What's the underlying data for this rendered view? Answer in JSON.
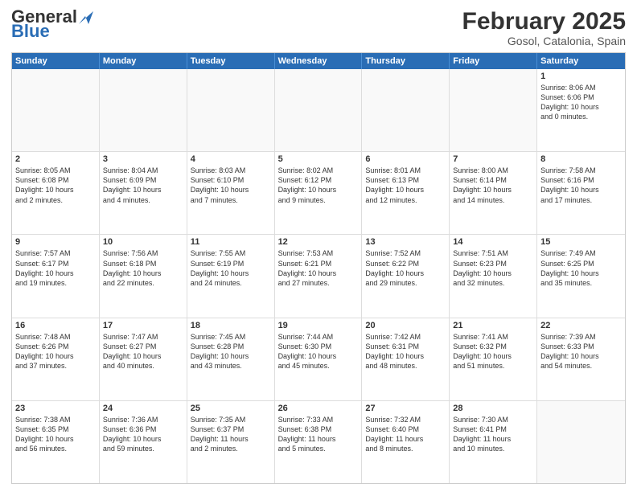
{
  "header": {
    "logo_general": "General",
    "logo_blue": "Blue",
    "month_title": "February 2025",
    "location": "Gosol, Catalonia, Spain"
  },
  "calendar": {
    "days_of_week": [
      "Sunday",
      "Monday",
      "Tuesday",
      "Wednesday",
      "Thursday",
      "Friday",
      "Saturday"
    ],
    "weeks": [
      [
        {
          "day": "",
          "info": ""
        },
        {
          "day": "",
          "info": ""
        },
        {
          "day": "",
          "info": ""
        },
        {
          "day": "",
          "info": ""
        },
        {
          "day": "",
          "info": ""
        },
        {
          "day": "",
          "info": ""
        },
        {
          "day": "1",
          "info": "Sunrise: 8:06 AM\nSunset: 6:06 PM\nDaylight: 10 hours\nand 0 minutes."
        }
      ],
      [
        {
          "day": "2",
          "info": "Sunrise: 8:05 AM\nSunset: 6:08 PM\nDaylight: 10 hours\nand 2 minutes."
        },
        {
          "day": "3",
          "info": "Sunrise: 8:04 AM\nSunset: 6:09 PM\nDaylight: 10 hours\nand 4 minutes."
        },
        {
          "day": "4",
          "info": "Sunrise: 8:03 AM\nSunset: 6:10 PM\nDaylight: 10 hours\nand 7 minutes."
        },
        {
          "day": "5",
          "info": "Sunrise: 8:02 AM\nSunset: 6:12 PM\nDaylight: 10 hours\nand 9 minutes."
        },
        {
          "day": "6",
          "info": "Sunrise: 8:01 AM\nSunset: 6:13 PM\nDaylight: 10 hours\nand 12 minutes."
        },
        {
          "day": "7",
          "info": "Sunrise: 8:00 AM\nSunset: 6:14 PM\nDaylight: 10 hours\nand 14 minutes."
        },
        {
          "day": "8",
          "info": "Sunrise: 7:58 AM\nSunset: 6:16 PM\nDaylight: 10 hours\nand 17 minutes."
        }
      ],
      [
        {
          "day": "9",
          "info": "Sunrise: 7:57 AM\nSunset: 6:17 PM\nDaylight: 10 hours\nand 19 minutes."
        },
        {
          "day": "10",
          "info": "Sunrise: 7:56 AM\nSunset: 6:18 PM\nDaylight: 10 hours\nand 22 minutes."
        },
        {
          "day": "11",
          "info": "Sunrise: 7:55 AM\nSunset: 6:19 PM\nDaylight: 10 hours\nand 24 minutes."
        },
        {
          "day": "12",
          "info": "Sunrise: 7:53 AM\nSunset: 6:21 PM\nDaylight: 10 hours\nand 27 minutes."
        },
        {
          "day": "13",
          "info": "Sunrise: 7:52 AM\nSunset: 6:22 PM\nDaylight: 10 hours\nand 29 minutes."
        },
        {
          "day": "14",
          "info": "Sunrise: 7:51 AM\nSunset: 6:23 PM\nDaylight: 10 hours\nand 32 minutes."
        },
        {
          "day": "15",
          "info": "Sunrise: 7:49 AM\nSunset: 6:25 PM\nDaylight: 10 hours\nand 35 minutes."
        }
      ],
      [
        {
          "day": "16",
          "info": "Sunrise: 7:48 AM\nSunset: 6:26 PM\nDaylight: 10 hours\nand 37 minutes."
        },
        {
          "day": "17",
          "info": "Sunrise: 7:47 AM\nSunset: 6:27 PM\nDaylight: 10 hours\nand 40 minutes."
        },
        {
          "day": "18",
          "info": "Sunrise: 7:45 AM\nSunset: 6:28 PM\nDaylight: 10 hours\nand 43 minutes."
        },
        {
          "day": "19",
          "info": "Sunrise: 7:44 AM\nSunset: 6:30 PM\nDaylight: 10 hours\nand 45 minutes."
        },
        {
          "day": "20",
          "info": "Sunrise: 7:42 AM\nSunset: 6:31 PM\nDaylight: 10 hours\nand 48 minutes."
        },
        {
          "day": "21",
          "info": "Sunrise: 7:41 AM\nSunset: 6:32 PM\nDaylight: 10 hours\nand 51 minutes."
        },
        {
          "day": "22",
          "info": "Sunrise: 7:39 AM\nSunset: 6:33 PM\nDaylight: 10 hours\nand 54 minutes."
        }
      ],
      [
        {
          "day": "23",
          "info": "Sunrise: 7:38 AM\nSunset: 6:35 PM\nDaylight: 10 hours\nand 56 minutes."
        },
        {
          "day": "24",
          "info": "Sunrise: 7:36 AM\nSunset: 6:36 PM\nDaylight: 10 hours\nand 59 minutes."
        },
        {
          "day": "25",
          "info": "Sunrise: 7:35 AM\nSunset: 6:37 PM\nDaylight: 11 hours\nand 2 minutes."
        },
        {
          "day": "26",
          "info": "Sunrise: 7:33 AM\nSunset: 6:38 PM\nDaylight: 11 hours\nand 5 minutes."
        },
        {
          "day": "27",
          "info": "Sunrise: 7:32 AM\nSunset: 6:40 PM\nDaylight: 11 hours\nand 8 minutes."
        },
        {
          "day": "28",
          "info": "Sunrise: 7:30 AM\nSunset: 6:41 PM\nDaylight: 11 hours\nand 10 minutes."
        },
        {
          "day": "",
          "info": ""
        }
      ]
    ]
  }
}
